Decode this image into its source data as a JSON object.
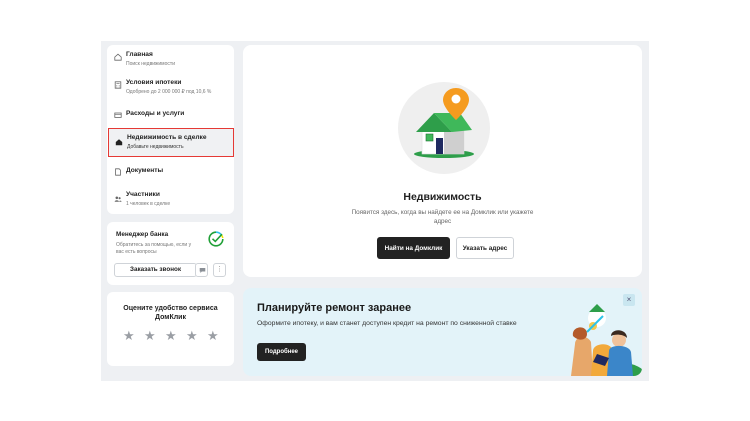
{
  "sidebar": {
    "items": [
      {
        "title": "Главная",
        "subtitle": "Поиск недвижимости",
        "icon": "home-icon"
      },
      {
        "title": "Условия ипотеки",
        "subtitle": "Одобрено до 2 000 000 ₽ под 10,6 %",
        "icon": "calculator-icon"
      },
      {
        "title": "Расходы и услуги",
        "subtitle": "",
        "icon": "wallet-icon"
      },
      {
        "title": "Недвижимость в сделке",
        "subtitle": "Добавьте недвижимость",
        "icon": "house-filled-icon",
        "active": true
      },
      {
        "title": "Документы",
        "subtitle": "",
        "icon": "document-icon"
      },
      {
        "title": "Участники",
        "subtitle": "1 человек в сделке",
        "icon": "people-icon"
      }
    ]
  },
  "manager": {
    "title": "Менеджер банка",
    "description": "Обратитесь за помощью, если у вас есть вопросы",
    "call_label": "Заказать звонок",
    "chat_icon": "chat-icon",
    "more_label": "⋮"
  },
  "rating": {
    "title": "Оцените удобство сервиса ДомКлик",
    "stars": 5
  },
  "main": {
    "title": "Недвижимость",
    "description": "Появится здесь, когда вы найдете ее на Домклик или укажете адрес",
    "find_label": "Найти на Домклик",
    "address_label": "Указать адрес"
  },
  "promo": {
    "title": "Планируйте ремонт заранее",
    "text": "Оформите ипотеку, и вам станет доступен кредит на ремонт по сниженной ставке",
    "button_label": "Подробнее",
    "close_label": "×"
  },
  "colors": {
    "accent_dark": "#222222",
    "active_border": "#e53935",
    "pin_orange": "#f59b1f",
    "house_green": "#2e9e4a"
  }
}
